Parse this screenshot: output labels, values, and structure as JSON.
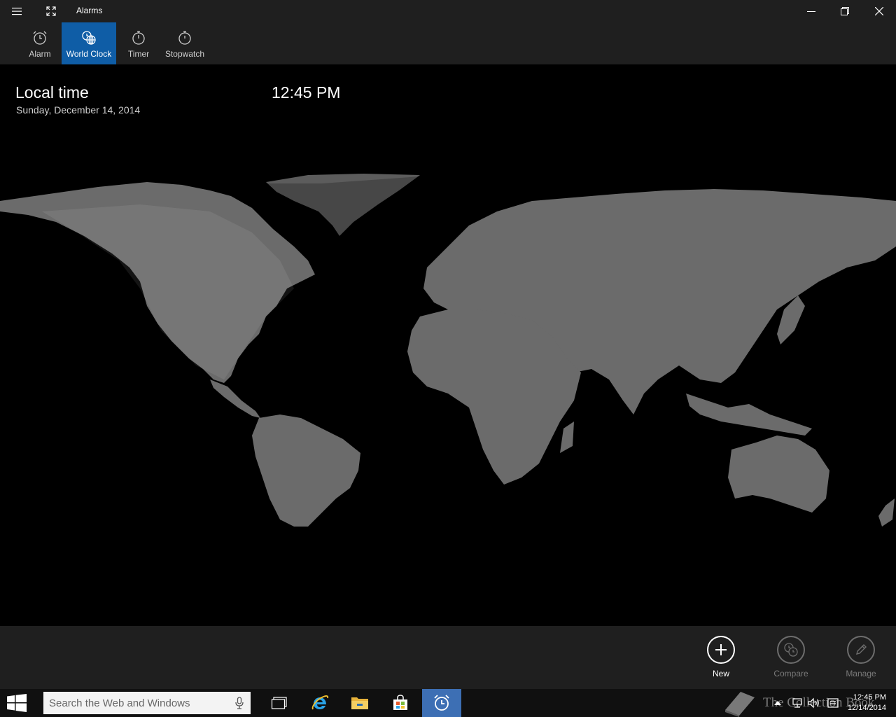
{
  "window": {
    "title": "Alarms",
    "menu_icon": "hamburger-icon",
    "fullscreen_icon": "fullscreen-icon",
    "controls": [
      "minimize-icon",
      "restore-icon",
      "close-icon"
    ]
  },
  "tabs": [
    {
      "label": "Alarm",
      "icon": "alarm-clock-icon",
      "active": false
    },
    {
      "label": "World Clock",
      "icon": "globe-clock-icon",
      "active": true
    },
    {
      "label": "Timer",
      "icon": "timer-icon",
      "active": false
    },
    {
      "label": "Stopwatch",
      "icon": "stopwatch-icon",
      "active": false
    }
  ],
  "local": {
    "label": "Local time",
    "date": "Sunday, December 14, 2014",
    "time": "12:45 PM"
  },
  "map": {
    "land_color": "#6b6b6b",
    "night_color": "#4e4e4e",
    "day_color": "#7a7a7a",
    "ocean_color": "#000000"
  },
  "appbar": {
    "new_label": "New",
    "compare_label": "Compare",
    "manage_label": "Manage"
  },
  "taskbar": {
    "search_placeholder": "Search the Web and Windows",
    "apps": [
      "task-view-icon",
      "internet-explorer-icon",
      "file-explorer-icon",
      "store-icon",
      "alarms-app-icon"
    ],
    "clock_time": "12:45 PM",
    "clock_date": "12/14/2014",
    "watermark": "The Collection Book"
  },
  "colors": {
    "accent": "#0f5da6",
    "chrome": "#1f1f1f",
    "taskbar": "#101010",
    "taskbar_active": "#3d6fb4"
  }
}
